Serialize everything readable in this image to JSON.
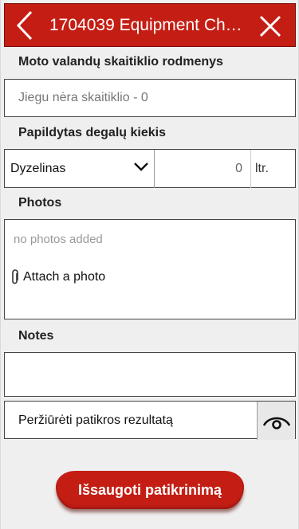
{
  "header": {
    "title": "1704039 Equipment Ch…",
    "back_icon": "chevron-left-icon",
    "close_icon": "close-icon",
    "color": "#c41e14"
  },
  "moto_hours": {
    "label": "Moto valandų skaitiklio rodmenys",
    "placeholder": "Jiegu nėra skaitiklio - 0",
    "value": ""
  },
  "fuel": {
    "label": "Papildytas degalų kiekis",
    "type_value": "Dyzelinas",
    "amount": "0",
    "unit": "ltr."
  },
  "photos": {
    "label": "Photos",
    "empty_text": "no photos added",
    "attach_label": "Attach a photo",
    "attach_icon": "paperclip-icon"
  },
  "notes": {
    "label": "Notes",
    "value": ""
  },
  "review": {
    "label": "Peržiūrėti patikros rezultatą",
    "icon": "eye-icon"
  },
  "save_button": {
    "label": "Išsaugoti patikrinimą"
  }
}
